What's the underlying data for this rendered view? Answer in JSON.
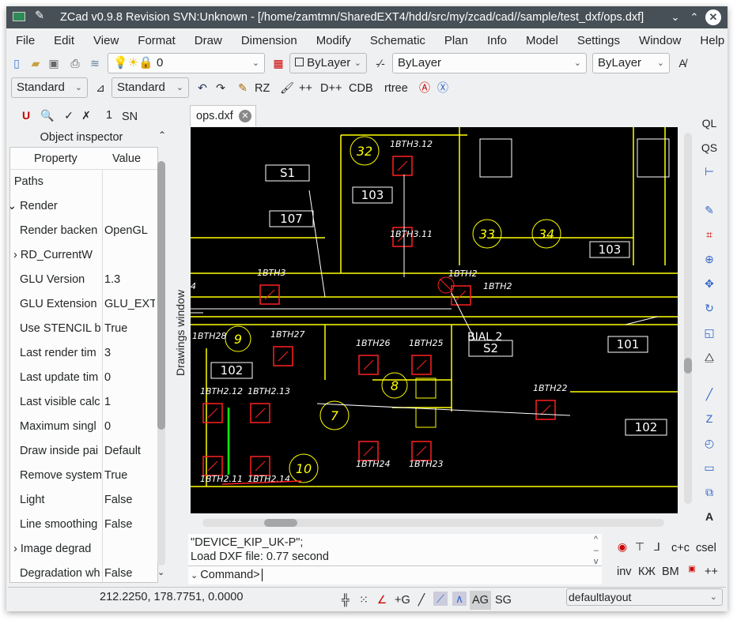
{
  "window": {
    "title": "ZCad v0.9.8 Revision SVN:Unknown - [/home/zamtmn/SharedEXT4/hdd/src/my/zcad/cad//sample/test_dxf/ops.dxf]"
  },
  "menu": [
    "File",
    "Edit",
    "View",
    "Format",
    "Draw",
    "Dimension",
    "Modify",
    "Schematic",
    "Plan",
    "Info",
    "Model",
    "Settings",
    "Window",
    "Help"
  ],
  "toolbar1": {
    "layer": "0",
    "color": "ByLayer",
    "linetype": "ByLayer",
    "lineweight": "ByLayer"
  },
  "toolbar2": {
    "text_style": "Standard",
    "dim_style": "Standard",
    "buttons": [
      "RZ",
      "++",
      "D++",
      "CDB",
      "rtree"
    ]
  },
  "toolbar3": {
    "snap_value": "1",
    "sn_label": "SN"
  },
  "inspector": {
    "title": "Object inspector",
    "col_property": "Property",
    "col_value": "Value",
    "rows": [
      {
        "k": "Paths",
        "v": "",
        "indent": 0,
        "exp": ">"
      },
      {
        "k": "Render",
        "v": "",
        "indent": 0,
        "exp": "v"
      },
      {
        "k": "Render backen",
        "v": "OpenGL",
        "indent": 1
      },
      {
        "k": "RD_CurrentW",
        "v": "",
        "indent": 1,
        "exp": ">"
      },
      {
        "k": "GLU Version",
        "v": "1.3",
        "indent": 1
      },
      {
        "k": "GLU Extension",
        "v": "GLU_EXT",
        "indent": 1
      },
      {
        "k": "Use STENCIL b",
        "v": "True",
        "indent": 1
      },
      {
        "k": "Last render tim",
        "v": "3",
        "indent": 1
      },
      {
        "k": "Last update tim",
        "v": "0",
        "indent": 1
      },
      {
        "k": "Last visible calc",
        "v": "1",
        "indent": 1
      },
      {
        "k": "Maximum singl",
        "v": "0",
        "indent": 1
      },
      {
        "k": "Draw inside pai",
        "v": "Default",
        "indent": 1
      },
      {
        "k": "Remove system",
        "v": "True",
        "indent": 1
      },
      {
        "k": "Light",
        "v": "False",
        "indent": 1
      },
      {
        "k": "Line smoothing",
        "v": "False",
        "indent": 1
      },
      {
        "k": "Image degrad",
        "v": "",
        "indent": 1,
        "exp": ">"
      },
      {
        "k": "Degradation wh",
        "v": "False",
        "indent": 1
      }
    ]
  },
  "drawings": {
    "side_label": "Drawings window",
    "tab": "ops.dxf"
  },
  "drawing_labels": [
    "S1",
    "103",
    "107",
    "1BTH3.12",
    "1BTH3.11",
    "32",
    "33",
    "34",
    "103",
    "1BTH3",
    "1BTH2",
    "BIAL 2",
    "S2",
    "101",
    "102",
    "102",
    "1BTH28",
    "1BTH27",
    "1BTH26",
    "1BTH25",
    "1BTH22",
    "1BTH2.12",
    "1BTH2.13",
    "1BTH2.11",
    "1BTH2.14",
    "1BTH24",
    "1BTH23",
    "9",
    "8",
    "7",
    "10"
  ],
  "command": {
    "lines": [
      "\"DEVICE_KIP_UK-P\";",
      "Load DXF file:  0.77 second"
    ],
    "prompt": "Command>"
  },
  "right_toolbar": [
    "QL",
    "QS"
  ],
  "bottom_right": {
    "row1": [
      "c+c",
      "csel"
    ],
    "row2": [
      "inv",
      "КЖ",
      "ВМ",
      "++"
    ]
  },
  "status": {
    "coords": "212.2250, 178.7751, 0.0000",
    "buttons": [
      "+G",
      "AG",
      "SG"
    ],
    "layout": "defaultlayout"
  },
  "colors": {
    "canvas": "#000000",
    "title_bar": "#475057",
    "red": "#ff2020",
    "yellow": "#ffff00",
    "white": "#ffffff",
    "green": "#00ff00"
  }
}
